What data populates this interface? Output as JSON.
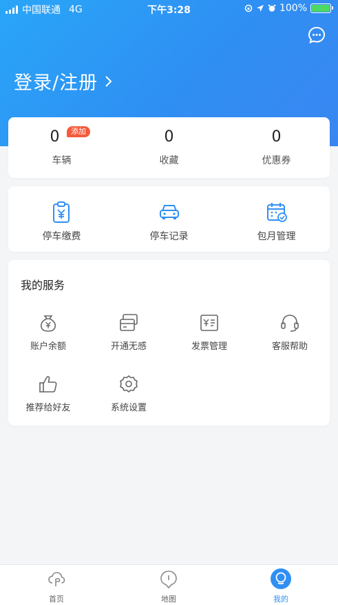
{
  "status_bar": {
    "carrier": "中国联通",
    "network": "4G",
    "time": "下午3:28",
    "battery": "100%"
  },
  "header": {
    "login_text": "登录/注册",
    "chevron": "›"
  },
  "stats": [
    {
      "value": "0",
      "label": "车辆",
      "badge": "添加"
    },
    {
      "value": "0",
      "label": "收藏"
    },
    {
      "value": "0",
      "label": "优惠券"
    }
  ],
  "functions": [
    {
      "label": "停车缴费",
      "icon": "payment-icon"
    },
    {
      "label": "停车记录",
      "icon": "car-icon"
    },
    {
      "label": "包月管理",
      "icon": "calendar-icon"
    }
  ],
  "services": {
    "title": "我的服务",
    "items": [
      {
        "label": "账户余额",
        "icon": "money-bag-icon"
      },
      {
        "label": "开通无感",
        "icon": "card-icon"
      },
      {
        "label": "发票管理",
        "icon": "invoice-icon"
      },
      {
        "label": "客服帮助",
        "icon": "headset-icon"
      },
      {
        "label": "推荐给好友",
        "icon": "thumbs-up-icon"
      },
      {
        "label": "系统设置",
        "icon": "gear-icon"
      }
    ]
  },
  "tabs": [
    {
      "label": "首页",
      "icon": "home-icon"
    },
    {
      "label": "地图",
      "icon": "map-pin-icon"
    },
    {
      "label": "我的",
      "icon": "profile-icon",
      "active": true
    }
  ],
  "colors": {
    "primary": "#2f8ff3",
    "badge": "#f55a3c",
    "background": "#f4f5f7"
  }
}
